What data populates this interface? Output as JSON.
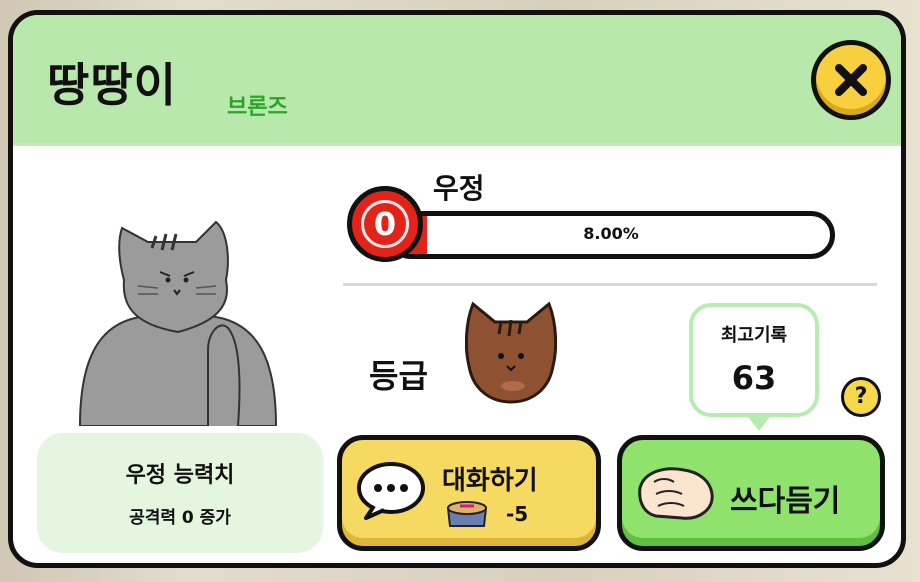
{
  "dialog": {
    "title": "땅땅이",
    "rank": "브론즈"
  },
  "friendship": {
    "label": "우정",
    "level": "0",
    "progress_text": "8.00%",
    "progress_fraction": 0.08,
    "bar_color": "#e2231a"
  },
  "grade": {
    "label": "등급",
    "icon": "brown-cat-face-icon"
  },
  "record": {
    "label": "최고기록",
    "value": "63"
  },
  "help": {
    "label": "?"
  },
  "stats": {
    "title": "우정 능력치",
    "detail": "공격력 0 증가"
  },
  "buttons": {
    "talk_label": "대화하기",
    "talk_cost": "-5",
    "talk_cost_icon": "cat-food-icon",
    "pet_label": "쓰다듬기",
    "pet_icon": "hand-icon"
  },
  "colors": {
    "header": "#b9e8ad",
    "rank": "#2aa526",
    "close": "#f7cf3f",
    "talk": "#f5d960",
    "pet": "#8fe36d"
  }
}
